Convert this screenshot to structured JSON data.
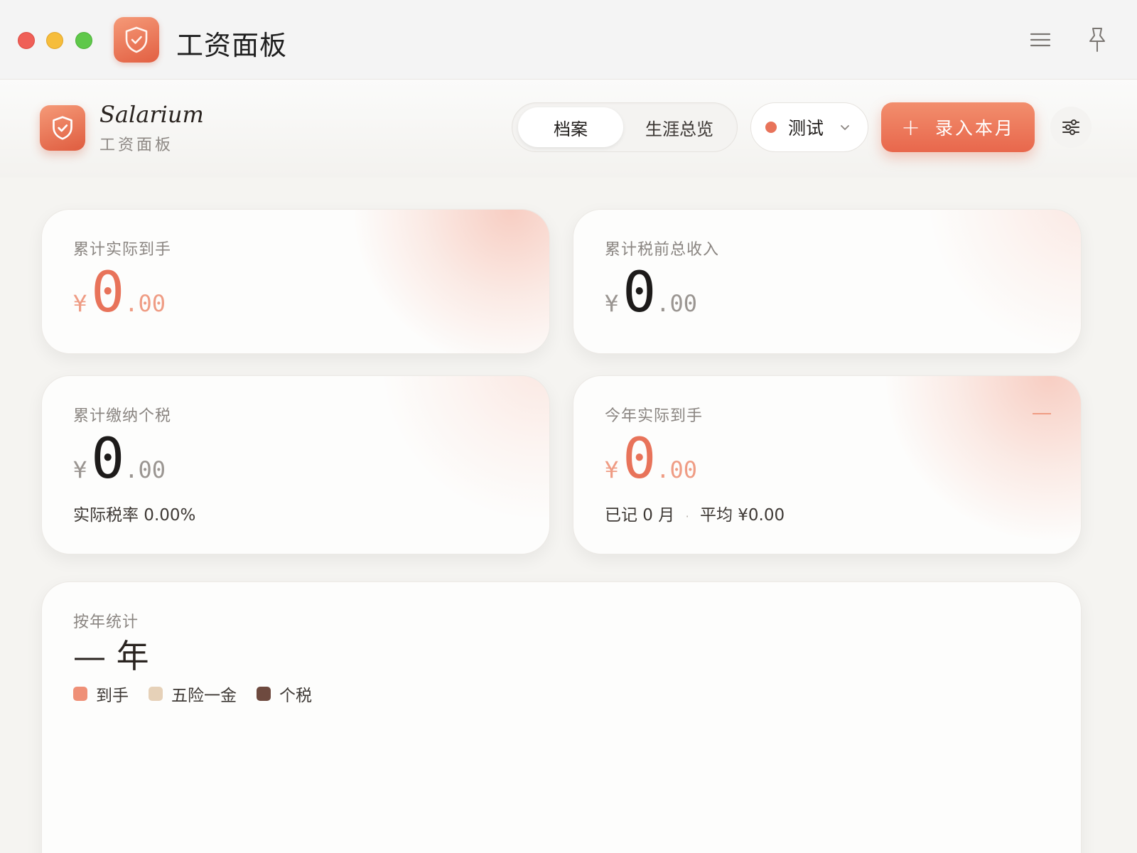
{
  "window": {
    "title": "工资面板"
  },
  "brand": {
    "name": "Salarium",
    "subtitle": "工资面板"
  },
  "tabs": [
    {
      "label": "档案",
      "active": true
    },
    {
      "label": "生涯总览",
      "active": false
    }
  ],
  "profile": {
    "label": "测试",
    "dot_color": "#e8735a"
  },
  "actions": {
    "add_label": "录入本月",
    "add_icon": "plus-icon",
    "settings_icon": "sliders-icon",
    "menu_icon": "hamburger-menu-icon",
    "pin_icon": "pin-icon"
  },
  "cards": {
    "net_total": {
      "label": "累计实际到手",
      "currency": "¥",
      "integer": "0",
      "decimal": ".00"
    },
    "gross_total": {
      "label": "累计税前总收入",
      "currency": "¥",
      "integer": "0",
      "decimal": ".00"
    },
    "tax_total": {
      "label": "累计缴纳个税",
      "currency": "¥",
      "integer": "0",
      "decimal": ".00",
      "footer": "实际税率 0.00%"
    },
    "year_net": {
      "label": "今年实际到手",
      "currency": "¥",
      "integer": "0",
      "decimal": ".00",
      "footer_months": "已记 0 月",
      "footer_sep": "·",
      "footer_avg": "平均 ¥0.00"
    }
  },
  "yearly": {
    "label": "按年统计",
    "value": "— 年",
    "legend": [
      {
        "label": "到手",
        "color": "#ef9077"
      },
      {
        "label": "五险一金",
        "color": "#e6d1b8"
      },
      {
        "label": "个税",
        "color": "#6e4a3f"
      }
    ]
  },
  "colors": {
    "accent": "#e8735a",
    "accent_light": "#ef9c84"
  }
}
